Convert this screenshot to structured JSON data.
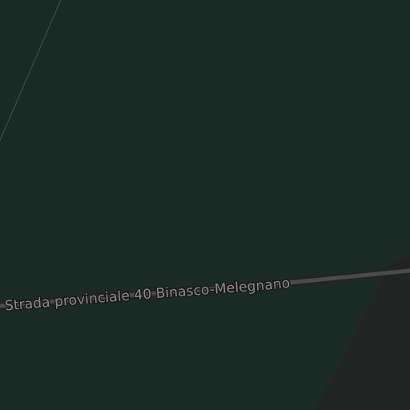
{
  "map": {
    "colors": {
      "land": "#1a2b26",
      "urban_area": "#222424",
      "road_casing": "#242424",
      "road_fill": "#4a4a4a",
      "label_text": "#8a8a8a",
      "label_halo": "#1a1a1a",
      "minor_line": "#3c524b"
    },
    "roads": [
      {
        "name": "Strada provinciale 40 Binasco-Melegnano"
      }
    ]
  }
}
